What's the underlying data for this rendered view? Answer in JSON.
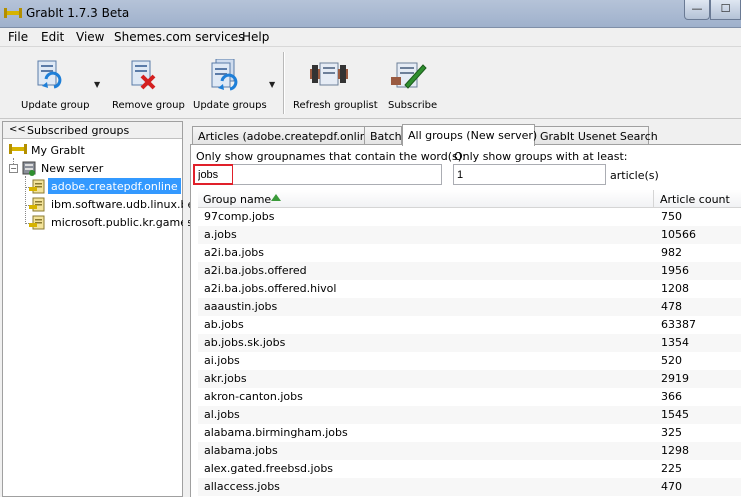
{
  "window": {
    "title": "GrabIt 1.7.3 Beta",
    "min_label": "—",
    "max_label": "☐"
  },
  "menu": [
    "File",
    "Edit",
    "View",
    "Shemes.com services",
    "Help"
  ],
  "toolbar": {
    "update_group": "Update group",
    "remove_group": "Remove group",
    "update_groups": "Update groups",
    "refresh_grouplist": "Refresh grouplist",
    "subscribe": "Subscribe"
  },
  "sidebar": {
    "header_chevron": "<<",
    "header_title": "Subscribed groups",
    "my_grabit": "My GrabIt",
    "server": "New server",
    "groups": [
      "adobe.createpdf.online",
      "ibm.software.udb.linux.beta",
      "microsoft.public.kr.games"
    ],
    "expander_minus": "−"
  },
  "tabs": [
    "Articles (adobe.createpdf.online)",
    "Batch",
    "All groups (New server)",
    "GrabIt Usenet Search"
  ],
  "filter": {
    "name_label": "Only show groupnames that contain the word(s):",
    "name_value": "jobs",
    "min_label": "Only show groups with at least:",
    "min_value": "1",
    "min_suffix": "article(s)"
  },
  "table": {
    "col_name": "Group name",
    "col_count": "Article count",
    "sort_direction": "ascending",
    "rows": [
      [
        "97comp.jobs",
        "750"
      ],
      [
        "a.jobs",
        "10566"
      ],
      [
        "a2i.ba.jobs",
        "982"
      ],
      [
        "a2i.ba.jobs.offered",
        "1956"
      ],
      [
        "a2i.ba.jobs.offered.hivol",
        "1208"
      ],
      [
        "aaaustin.jobs",
        "478"
      ],
      [
        "ab.jobs",
        "63387"
      ],
      [
        "ab.jobs.sk.jobs",
        "1354"
      ],
      [
        "ai.jobs",
        "520"
      ],
      [
        "akr.jobs",
        "2919"
      ],
      [
        "akron-canton.jobs",
        "366"
      ],
      [
        "al.jobs",
        "1545"
      ],
      [
        "alabama.birmingham.jobs",
        "325"
      ],
      [
        "alabama.jobs",
        "1298"
      ],
      [
        "alex.gated.freebsd.jobs",
        "225"
      ],
      [
        "allaccess.jobs",
        "470"
      ]
    ]
  },
  "colors": {
    "selection": "#3399ff",
    "highlight_border": "#e0202a",
    "sort_arrow": "#3a9a3a"
  }
}
